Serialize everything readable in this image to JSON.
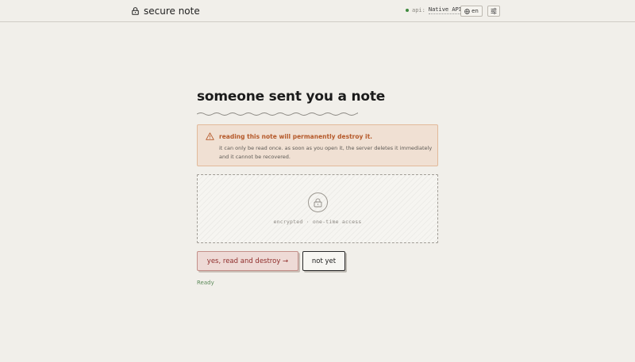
{
  "header": {
    "brand_name": "secure note",
    "api_label": "api:",
    "api_value": "Native API",
    "lang_label": "en"
  },
  "main": {
    "title": "someone sent you a note",
    "warning": {
      "heading": "reading this note will permanently destroy it.",
      "body": "it can only be read once. as soon as you open it, the server deletes it immediately and it cannot be recovered."
    },
    "cipher_caption": "encrypted · one-time access",
    "destroy_button": "yes, read and destroy →",
    "not_yet_button": "not yet",
    "status": "Ready"
  },
  "colors": {
    "background": "#f1efea",
    "warning_bg": "#f0e0d3",
    "warning_text": "#b5592a",
    "destroy_bg": "#eedad6",
    "destroy_text": "#8e2c2a",
    "status_ok": "#5d8a5a",
    "api_dot": "#3f8a3f"
  },
  "icons": {
    "brand": "lock-icon",
    "lang": "globe-icon",
    "settings": "sliders-icon",
    "warning": "warning-triangle-icon",
    "cipher": "lock-icon"
  }
}
